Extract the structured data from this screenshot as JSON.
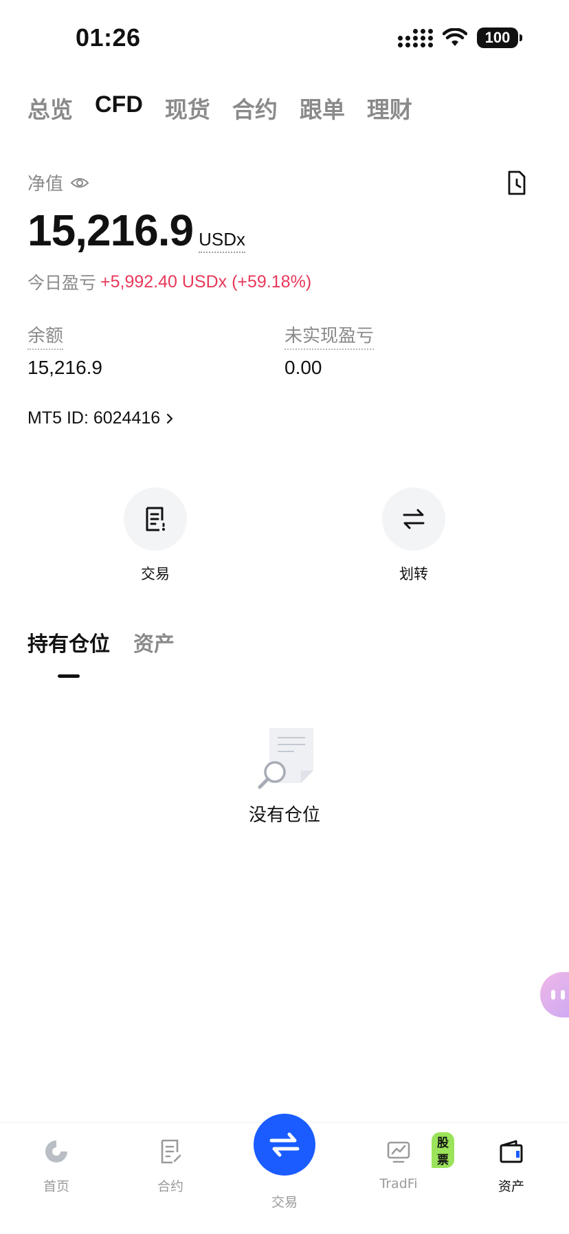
{
  "status_bar": {
    "time": "01:26",
    "battery": "100"
  },
  "top_tabs": [
    {
      "label": "总览"
    },
    {
      "label": "CFD",
      "active": true
    },
    {
      "label": "现货"
    },
    {
      "label": "合约"
    },
    {
      "label": "跟单"
    },
    {
      "label": "理财"
    }
  ],
  "account": {
    "net_value_label": "净值",
    "net_value": "15,216.9",
    "net_value_unit": "USDx",
    "today_pnl_label": "今日盈亏",
    "today_pnl_value": "+5,992.40 USDx (+59.18%)",
    "balance_label": "余额",
    "balance_value": "15,216.9",
    "unrealized_label": "未实现盈亏",
    "unrealized_value": "0.00",
    "mt5_id": "MT5 ID: 6024416"
  },
  "actions": {
    "trade_label": "交易",
    "transfer_label": "划转"
  },
  "sub_tabs": [
    {
      "label": "持有仓位",
      "active": true
    },
    {
      "label": "资产"
    }
  ],
  "empty_state": {
    "text": "没有仓位"
  },
  "bottom_nav": {
    "home": "首页",
    "futures": "合约",
    "trade": "交易",
    "tradfi": "TradFi",
    "tradfi_badge": "股票",
    "assets": "资产"
  },
  "colors": {
    "accent": "#1a5cff",
    "pnl_positive": "#e8385a",
    "badge": "#9be35a"
  }
}
